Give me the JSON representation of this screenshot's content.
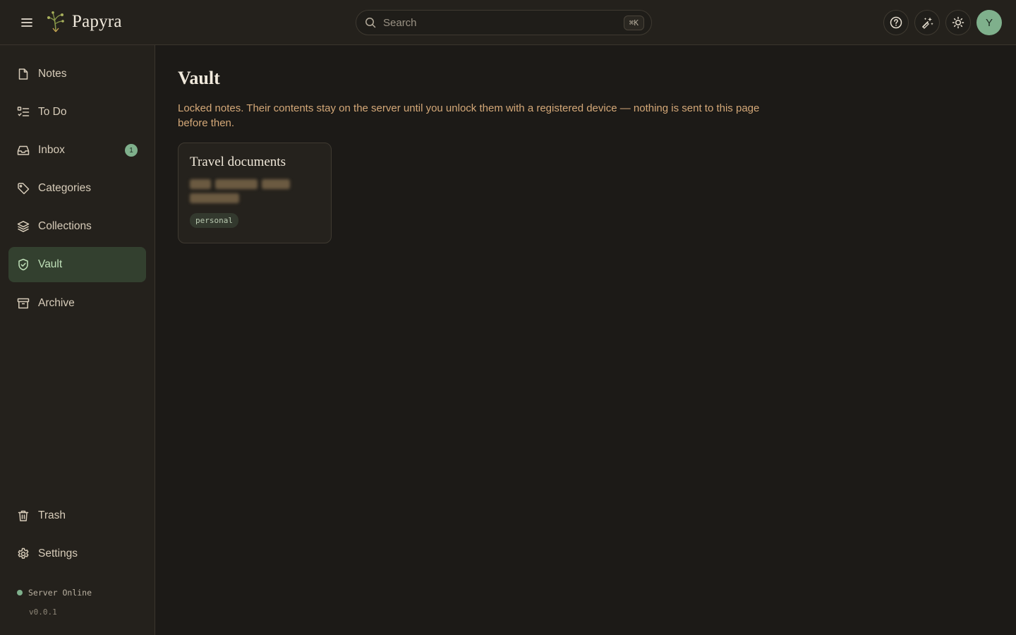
{
  "app": {
    "name": "Papyra"
  },
  "search": {
    "placeholder": "Search",
    "shortcut": "⌘K"
  },
  "header": {
    "avatar_initial": "Y"
  },
  "sidebar": {
    "items": [
      {
        "label": "Notes"
      },
      {
        "label": "To Do"
      },
      {
        "label": "Inbox",
        "badge": "1"
      },
      {
        "label": "Categories"
      },
      {
        "label": "Collections"
      },
      {
        "label": "Vault"
      },
      {
        "label": "Archive"
      }
    ],
    "bottom_items": [
      {
        "label": "Trash"
      },
      {
        "label": "Settings"
      }
    ],
    "status": "Server Online",
    "version": "v0.0.1"
  },
  "page": {
    "title": "Vault",
    "description": "Locked notes. Their contents stay on the server until you unlock them with a registered device — nothing is sent to this page before then."
  },
  "cards": [
    {
      "title": "Travel documents",
      "tag": "personal"
    }
  ],
  "colors": {
    "accent": "#7fb08c",
    "background": "#1c1a17",
    "sidebar": "#24211c",
    "description_text": "#d4a878"
  }
}
